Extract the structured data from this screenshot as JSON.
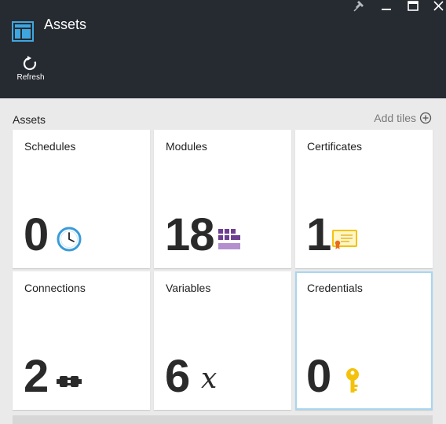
{
  "window": {
    "title": "Assets",
    "icons": [
      "pin-icon",
      "minimize-icon",
      "maximize-icon",
      "close-icon"
    ]
  },
  "toolbar": {
    "refresh_label": "Refresh",
    "refresh_icon": "refresh-icon"
  },
  "section": {
    "title": "Assets",
    "add_tiles_label": "Add tiles",
    "add_tiles_icon": "plus-circle-icon"
  },
  "tiles": [
    {
      "label": "Schedules",
      "count": "0",
      "icon": "clock-icon"
    },
    {
      "label": "Modules",
      "count": "18",
      "icon": "modules-grid-icon"
    },
    {
      "label": "Certificates",
      "count": "1",
      "icon": "certificate-icon"
    },
    {
      "label": "Connections",
      "count": "2",
      "icon": "connection-plug-icon"
    },
    {
      "label": "Variables",
      "count": "6",
      "icon": "variable-x-icon"
    },
    {
      "label": "Credentials",
      "count": "0",
      "icon": "key-icon"
    }
  ],
  "colors": {
    "header_bg": "#262a31",
    "content_bg": "#eaeaea",
    "tile_bg": "#ffffff",
    "selected_border": "#a8d6f0",
    "clock_blue": "#3a9bd9",
    "modules_purple": "#6d3e91",
    "certificate_yellow": "#f4c20d",
    "key_yellow": "#f4c20d"
  }
}
